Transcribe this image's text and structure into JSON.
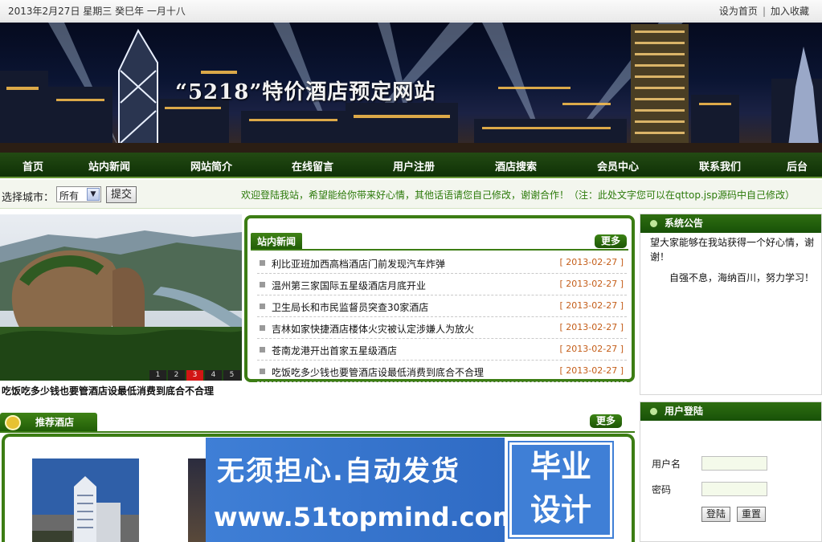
{
  "topbar": {
    "date": "2013年2月27日  星期三  癸巳年  一月十八",
    "set_home": "设为首页",
    "separator": "|",
    "add_favorite": "加入收藏"
  },
  "banner": {
    "title": "“5218”特价酒店预定网站"
  },
  "nav": {
    "items": [
      "首页",
      "站内新闻",
      "网站简介",
      "在线留言",
      "用户注册",
      "酒店搜索",
      "会员中心",
      "联系我们",
      "后台"
    ]
  },
  "citybar": {
    "label": "选择城市：",
    "selected_city": "所有",
    "submit": "提交",
    "marquee": "欢迎登陆我站，希望能给你带来好心情，其他话语请您自己修改，谢谢合作！（注：此处文字您可以在qttop.jsp源码中自己修改）"
  },
  "slideshow": {
    "pages": [
      "1",
      "2",
      "3",
      "4",
      "5"
    ],
    "active_page": "3",
    "caption": "吃饭吃多少钱也要管酒店设最低消费到底合不合理"
  },
  "news": {
    "title": "站内新闻",
    "more": "更多",
    "items": [
      {
        "title": "利比亚班加西高档酒店门前发现汽车炸弹",
        "date": "[ 2013-02-27 ]"
      },
      {
        "title": "温州第三家国际五星级酒店月底开业",
        "date": "[ 2013-02-27 ]"
      },
      {
        "title": "卫生局长和市民监督员突查30家酒店",
        "date": "[ 2013-02-27 ]"
      },
      {
        "title": "吉林如家快捷酒店楼体火灾被认定涉嫌人为放火",
        "date": "[ 2013-02-27 ]"
      },
      {
        "title": "苍南龙港开出首家五星级酒店",
        "date": "[ 2013-02-27 ]"
      },
      {
        "title": "吃饭吃多少钱也要管酒店设最低消费到底合不合理",
        "date": "[ 2013-02-27 ]"
      }
    ]
  },
  "notice": {
    "title": "系统公告",
    "text1": "望大家能够在我站获得一个好心情，谢谢！",
    "text2": "自强不息，海纳百川，努力学习！"
  },
  "login": {
    "title": "用户登陆",
    "username_label": "用户名",
    "password_label": "密码",
    "login_button": "登陆",
    "reset_button": "重置"
  },
  "recommend": {
    "title": "推荐酒店",
    "more": "更多"
  },
  "ad": {
    "slogan": "无须担心.自动发货",
    "url": "www.51topmind.com",
    "badge_line1": "毕业",
    "badge_line2": "设计"
  },
  "colors": {
    "nav_green": "#1a4209",
    "accent_green": "#3c7d14",
    "date_orange": "#c45d18",
    "marquee_green": "#2c7a0a",
    "ad_blue": "#3f7fd6"
  }
}
